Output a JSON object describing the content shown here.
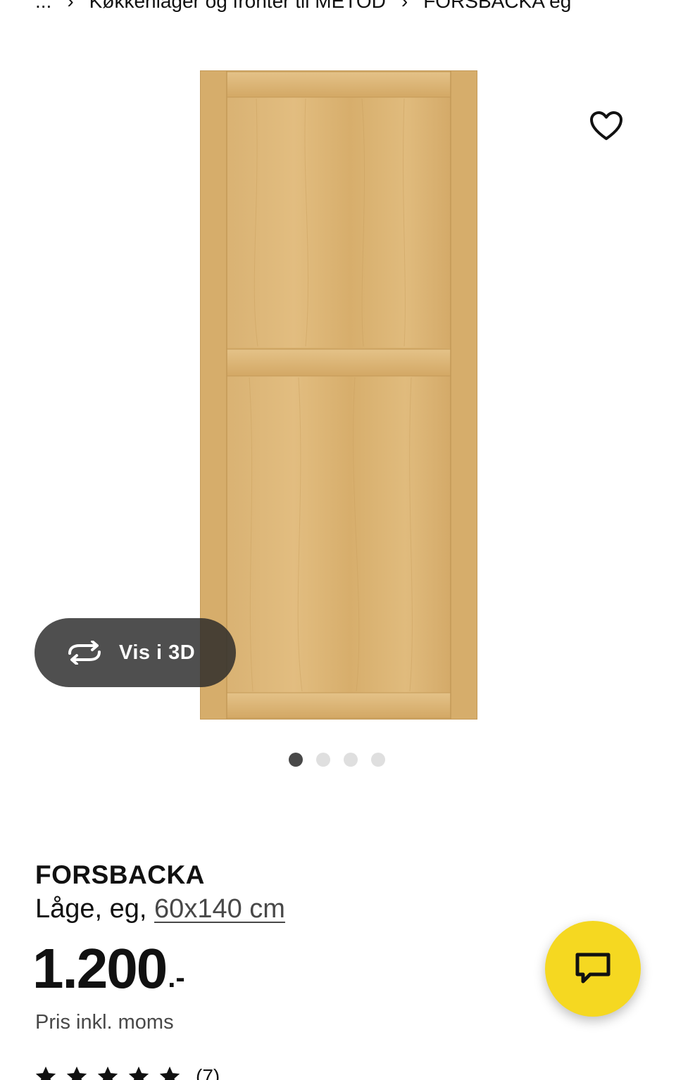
{
  "breadcrumb": {
    "ellipsis": "...",
    "items": [
      "Køkkenlåger og fronter til METOD",
      "FORSBACKA eg"
    ]
  },
  "gallery": {
    "view_3d_label": "Vis i 3D",
    "active_index": 0,
    "total_images": 4
  },
  "product": {
    "name": "FORSBACKA",
    "description_prefix": "Låge, eg, ",
    "size": "60x140 cm",
    "price_amount": "1.200",
    "price_suffix": ".-",
    "price_note": "Pris inkl. moms",
    "rating_count": "(7)",
    "rating_stars": 5
  },
  "colors": {
    "fab": "#f5d821",
    "oak": "#dcb677"
  },
  "icons": {
    "wishlist": "heart-outline-icon",
    "view_3d": "rotate-3d-icon",
    "chat": "chat-bubble-icon",
    "breadcrumb_separator": "chevron-right-icon"
  }
}
